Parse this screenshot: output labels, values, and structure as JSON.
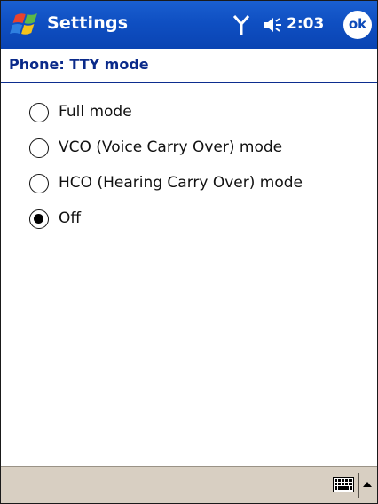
{
  "titlebar": {
    "title": "Settings",
    "time": "2:03",
    "ok_label": "ok",
    "start_icon": "windows-flag-icon",
    "signal_icon": "antenna-icon",
    "volume_icon": "speaker-icon"
  },
  "header": {
    "title": "Phone: TTY mode"
  },
  "tty_options": [
    {
      "label": "Full mode",
      "selected": false
    },
    {
      "label": "VCO (Voice Carry Over) mode",
      "selected": false
    },
    {
      "label": "HCO (Hearing Carry Over) mode",
      "selected": false
    },
    {
      "label": "Off",
      "selected": true
    }
  ],
  "menubar": {
    "input_icon": "keyboard-icon",
    "input_arrow_icon": "up-arrow-icon"
  },
  "colors": {
    "titlebar_blue": "#0f4fc2",
    "header_text": "#0a2a8a",
    "menubar_bg": "#d8cfc2"
  }
}
